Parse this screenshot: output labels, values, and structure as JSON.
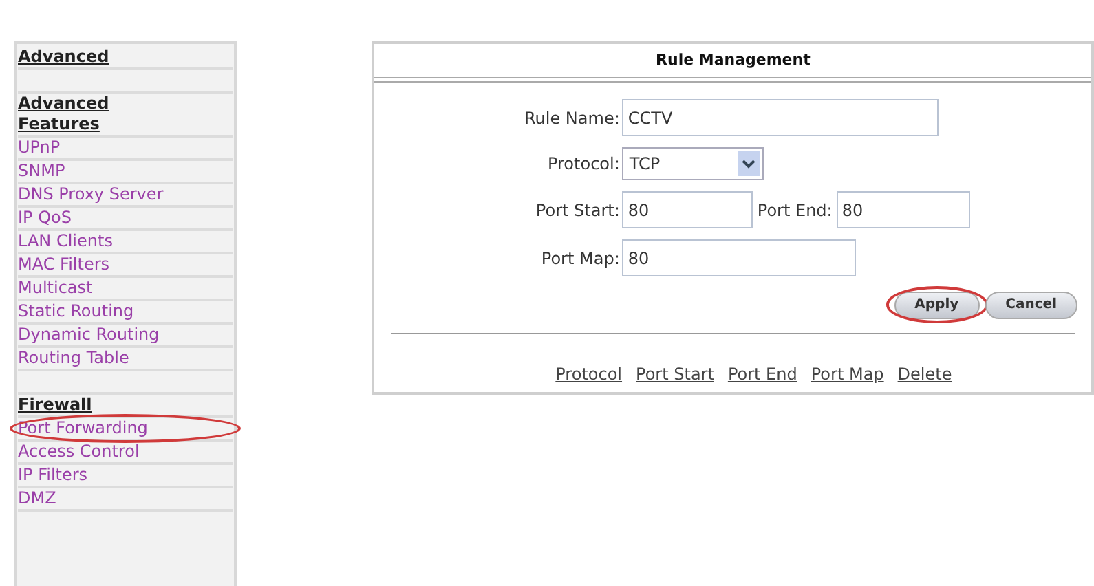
{
  "sidebar": {
    "sections": [
      {
        "title": "Advanced"
      },
      {
        "title": "Advanced Features",
        "items": [
          {
            "label": "UPnP",
            "circled": false
          },
          {
            "label": "SNMP",
            "circled": false
          },
          {
            "label": "DNS Proxy Server",
            "circled": false
          },
          {
            "label": "IP QoS",
            "circled": false
          },
          {
            "label": "LAN Clients",
            "circled": false
          },
          {
            "label": "MAC Filters",
            "circled": false
          },
          {
            "label": "Multicast",
            "circled": false
          },
          {
            "label": "Static Routing",
            "circled": false
          },
          {
            "label": "Dynamic Routing",
            "circled": false
          },
          {
            "label": "Routing Table",
            "circled": false
          }
        ]
      },
      {
        "title": "Firewall",
        "items": [
          {
            "label": "Port Forwarding",
            "circled": true
          },
          {
            "label": "Access Control",
            "circled": false
          },
          {
            "label": "IP Filters",
            "circled": false
          },
          {
            "label": "DMZ",
            "circled": false
          }
        ]
      }
    ]
  },
  "panel": {
    "title": "Rule Management",
    "fields": [
      {
        "kind": "text",
        "label": "Rule Name:",
        "value": "CCTV"
      },
      {
        "kind": "select",
        "label": "Protocol:",
        "value": "TCP"
      },
      {
        "kind": "pair",
        "label": "Port Start:",
        "value": "80",
        "label2": "Port End:",
        "value2": "80"
      },
      {
        "kind": "text",
        "label": "Port Map:",
        "value": "80"
      }
    ],
    "buttons": [
      {
        "label": "Apply",
        "circled": true
      },
      {
        "label": "Cancel",
        "circled": false
      }
    ],
    "columns": [
      "Protocol",
      "Port Start",
      "Port End",
      "Port Map",
      "Delete"
    ]
  }
}
